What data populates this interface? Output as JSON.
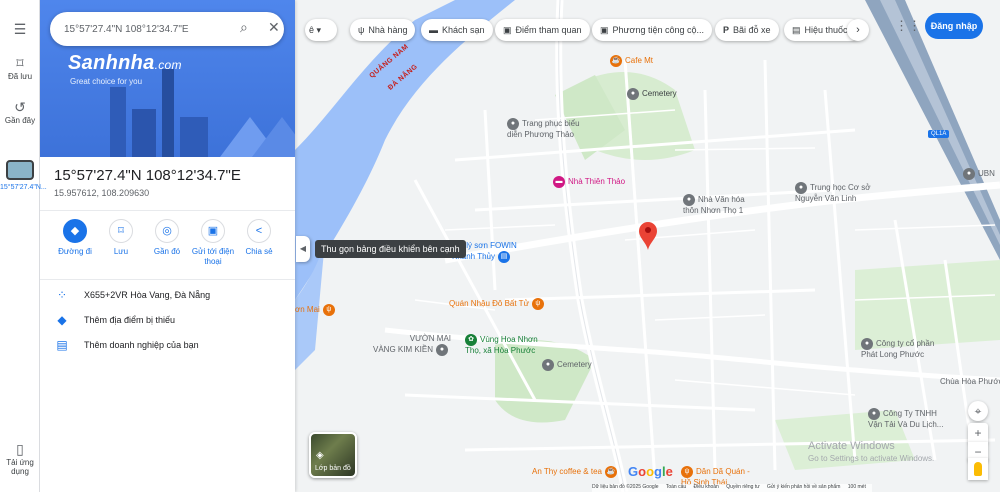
{
  "rail": {
    "items": [
      {
        "id": "menu",
        "icon": "☰",
        "label": ""
      },
      {
        "id": "saved",
        "icon": "⌑",
        "label": "Đã lưu"
      },
      {
        "id": "recent",
        "icon": "↺",
        "label": "Gần đây"
      }
    ],
    "recent_place": "15°57'27.4\"N...",
    "install": {
      "icon": "▯",
      "label": "Tải ứng dụng"
    }
  },
  "search": {
    "value": "15°57'27.4\"N 108°12'34.7\"E"
  },
  "hero": {
    "brand": "Sanhnha",
    "brand_suffix": ".com",
    "tagline": "Great choice for you"
  },
  "place": {
    "title": "15°57'27.4\"N 108°12'34.7\"E",
    "decimal": "15.957612, 108.209630"
  },
  "actions": [
    {
      "id": "directions",
      "icon": "◆",
      "label": "Đường đi"
    },
    {
      "id": "save",
      "icon": "⌑",
      "label": "Lưu"
    },
    {
      "id": "nearby",
      "icon": "◎",
      "label": "Gần đó"
    },
    {
      "id": "send-to-phone",
      "icon": "▣",
      "label": "Gửi tới điện thoại"
    },
    {
      "id": "share",
      "icon": "<",
      "label": "Chia sẻ"
    }
  ],
  "info_rows": [
    {
      "id": "plus-code",
      "icon": "⁘",
      "text": "X655+2VR Hòa Vang, Đà Nẵng"
    },
    {
      "id": "add-place",
      "icon": "◆",
      "text": "Thêm địa điểm bị thiếu"
    },
    {
      "id": "add-business",
      "icon": "▤",
      "text": "Thêm doanh nghiệp của bạn"
    }
  ],
  "collapse_tooltip": "Thu gọn bảng điều khiển bên cạnh",
  "chips": [
    {
      "id": "restaurants",
      "icon": "ψ",
      "label": "Nhà hàng"
    },
    {
      "id": "hotels",
      "icon": "▬",
      "label": "Khách sạn"
    },
    {
      "id": "attractions",
      "icon": "▣",
      "label": "Điểm tham quan"
    },
    {
      "id": "transit",
      "icon": "▣",
      "label": "Phương tiện công cộ..."
    },
    {
      "id": "parking",
      "icon": "P",
      "label": "Bãi đỗ xe"
    },
    {
      "id": "pharmacy",
      "icon": "▤",
      "label": "Hiệu thuốc"
    }
  ],
  "signin": "Đăng nhập",
  "map": {
    "road_label_1": "QUẢNG NAM",
    "road_label_2": "ĐÀ NẴNG",
    "highway": "QL1A",
    "pois": [
      {
        "id": "cafe-mt",
        "text": "Cafe Mt",
        "kind": "food"
      },
      {
        "id": "cemetery-top",
        "text": "Cemetery",
        "kind": "cemetery"
      },
      {
        "id": "trang-phuc",
        "text": "Trang phục biểu\ndiễn Phương Thảo",
        "kind": "shop"
      },
      {
        "id": "nha-thien-thao",
        "text": "Nhà Thiên Thảo",
        "kind": "hotel"
      },
      {
        "id": "nha-van-hoa",
        "text": "Nhà Văn hóa\nthôn Nhơn Thọ 1",
        "kind": "gov"
      },
      {
        "id": "truong-thcs",
        "text": "Trung học Cơ sở\nNguyễn Văn Linh",
        "kind": "gov"
      },
      {
        "id": "ubnd",
        "text": "UBN",
        "kind": "gov"
      },
      {
        "id": "dai-ly-son",
        "text": "Đại lý sơn FOWIN\nKhánh Thủy",
        "kind": "shop"
      },
      {
        "id": "quan-nhau",
        "text": "Quán Nhậu Đô Bất Tử",
        "kind": "food"
      },
      {
        "id": "on-mai",
        "text": "ơn Mai",
        "kind": "food"
      },
      {
        "id": "vuon-mai",
        "text": "VƯỜN MAI\nVÀNG KIM KIỀN",
        "kind": "gov"
      },
      {
        "id": "vung-hoa",
        "text": "Vùng Hoa Nhơn\nThọ, xã Hòa Phước",
        "kind": "park"
      },
      {
        "id": "cemetery-mid",
        "text": "Cemetery",
        "kind": "cemetery"
      },
      {
        "id": "cong-ty-phat-long",
        "text": "Công ty cổ phần\nPhát Long Phước",
        "kind": "gov"
      },
      {
        "id": "chua-hoa-phuoc",
        "text": "Chùa Hòa Phước",
        "kind": "plain"
      },
      {
        "id": "cong-ty-tnhh",
        "text": "Công Ty TNHH\nVận Tải Và Du Lịch...",
        "kind": "gov"
      },
      {
        "id": "an-thy",
        "text": "An Thy coffee & tea",
        "kind": "food"
      },
      {
        "id": "dan-da-quan",
        "text": "Dân Dã Quán -\nHồ Sinh Thái",
        "kind": "food"
      }
    ]
  },
  "layers_label": "Lớp bản đồ",
  "google_logo": "Google",
  "attribution": [
    "Dữ liệu bản đồ ©2025 Google",
    "Toàn cầu",
    "Điều khoản",
    "Quyền riêng tư",
    "Gửi ý kiến phản hồi về sản phẩm",
    "100 mét"
  ],
  "watermark": {
    "line1": "Activate Windows",
    "line2": "Go to Settings to activate Windows."
  },
  "colors": {
    "accent": "#1a73e8",
    "marker": "#ea4335",
    "water": "#9cc0f9",
    "park": "#c8e6c9",
    "highway": "#8fa5bf"
  }
}
